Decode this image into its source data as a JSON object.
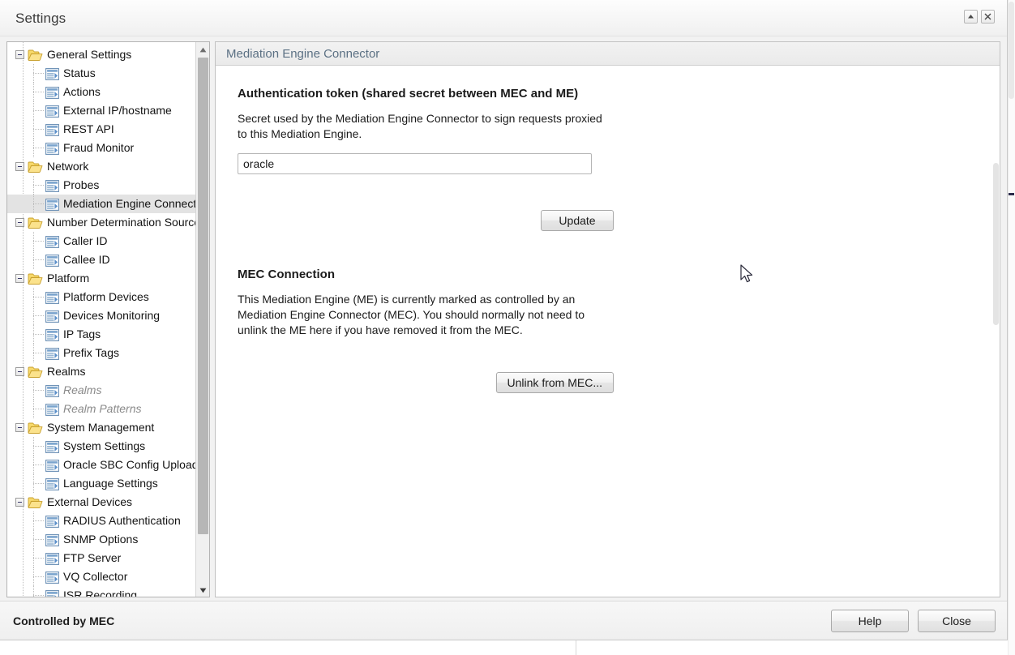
{
  "window": {
    "title": "Settings",
    "controls": [
      {
        "name": "collapse-button",
        "icon": "triangle-up-icon",
        "label": ""
      },
      {
        "name": "close-button",
        "icon": "close-x-icon",
        "label": ""
      }
    ]
  },
  "tree": {
    "scrollbar": {
      "up_arrow": "▲",
      "down_arrow": "▼"
    },
    "items": [
      {
        "label": "General Settings",
        "type": "group",
        "expanded": true,
        "selected": false,
        "disabled": false
      },
      {
        "label": "Status",
        "type": "leaf",
        "selected": false,
        "disabled": false
      },
      {
        "label": "Actions",
        "type": "leaf",
        "selected": false,
        "disabled": false
      },
      {
        "label": "External IP/hostname",
        "type": "leaf",
        "selected": false,
        "disabled": false
      },
      {
        "label": "REST API",
        "type": "leaf",
        "selected": false,
        "disabled": false
      },
      {
        "label": "Fraud Monitor",
        "type": "leaf",
        "selected": false,
        "disabled": false
      },
      {
        "label": "Network",
        "type": "group",
        "expanded": true,
        "selected": false,
        "disabled": false
      },
      {
        "label": "Probes",
        "type": "leaf",
        "selected": false,
        "disabled": false
      },
      {
        "label": "Mediation Engine Connector",
        "type": "leaf",
        "selected": true,
        "disabled": false
      },
      {
        "label": "Number Determination Sources",
        "type": "group",
        "expanded": true,
        "selected": false,
        "disabled": false
      },
      {
        "label": "Caller ID",
        "type": "leaf",
        "selected": false,
        "disabled": false
      },
      {
        "label": "Callee ID",
        "type": "leaf",
        "selected": false,
        "disabled": false
      },
      {
        "label": "Platform",
        "type": "group",
        "expanded": true,
        "selected": false,
        "disabled": false
      },
      {
        "label": "Platform Devices",
        "type": "leaf",
        "selected": false,
        "disabled": false
      },
      {
        "label": "Devices Monitoring",
        "type": "leaf",
        "selected": false,
        "disabled": false
      },
      {
        "label": "IP Tags",
        "type": "leaf",
        "selected": false,
        "disabled": false
      },
      {
        "label": "Prefix Tags",
        "type": "leaf",
        "selected": false,
        "disabled": false
      },
      {
        "label": "Realms",
        "type": "group",
        "expanded": true,
        "selected": false,
        "disabled": false
      },
      {
        "label": "Realms",
        "type": "leaf",
        "selected": false,
        "disabled": true
      },
      {
        "label": "Realm Patterns",
        "type": "leaf",
        "selected": false,
        "disabled": true
      },
      {
        "label": "System Management",
        "type": "group",
        "expanded": true,
        "selected": false,
        "disabled": false
      },
      {
        "label": "System Settings",
        "type": "leaf",
        "selected": false,
        "disabled": false
      },
      {
        "label": "Oracle SBC Config Upload",
        "type": "leaf",
        "selected": false,
        "disabled": false
      },
      {
        "label": "Language Settings",
        "type": "leaf",
        "selected": false,
        "disabled": false
      },
      {
        "label": "External Devices",
        "type": "group",
        "expanded": true,
        "selected": false,
        "disabled": false
      },
      {
        "label": "RADIUS Authentication",
        "type": "leaf",
        "selected": false,
        "disabled": false
      },
      {
        "label": "SNMP Options",
        "type": "leaf",
        "selected": false,
        "disabled": false
      },
      {
        "label": "FTP Server",
        "type": "leaf",
        "selected": false,
        "disabled": false
      },
      {
        "label": "VQ Collector",
        "type": "leaf",
        "selected": false,
        "disabled": false
      },
      {
        "label": "ISR Recording",
        "type": "leaf",
        "selected": false,
        "disabled": false
      }
    ]
  },
  "content": {
    "header_title": "Mediation Engine Connector",
    "auth_section": {
      "title": "Authentication token (shared secret between MEC and ME)",
      "description": "Secret used by the Mediation Engine Connector to sign requests proxied to this Mediation Engine.",
      "token_value": "oracle",
      "token_placeholder": "",
      "update_button": "Update"
    },
    "mec_section": {
      "title": "MEC Connection",
      "description": "This Mediation Engine (ME) is currently marked as controlled by an Mediation Engine Connector (MEC). You should normally not need to unlink the ME here if you have removed it from the MEC.",
      "unlink_button": "Unlink from MEC..."
    }
  },
  "footer": {
    "status": "Controlled by MEC",
    "help_button": "Help",
    "close_button": "Close"
  },
  "colors": {
    "header_text": "#5c7184",
    "selection": "#e3e3e3",
    "folder": "#f3c44b",
    "page_icon": "#5b8fc9",
    "dialog_bg": "#f2f2f2"
  }
}
